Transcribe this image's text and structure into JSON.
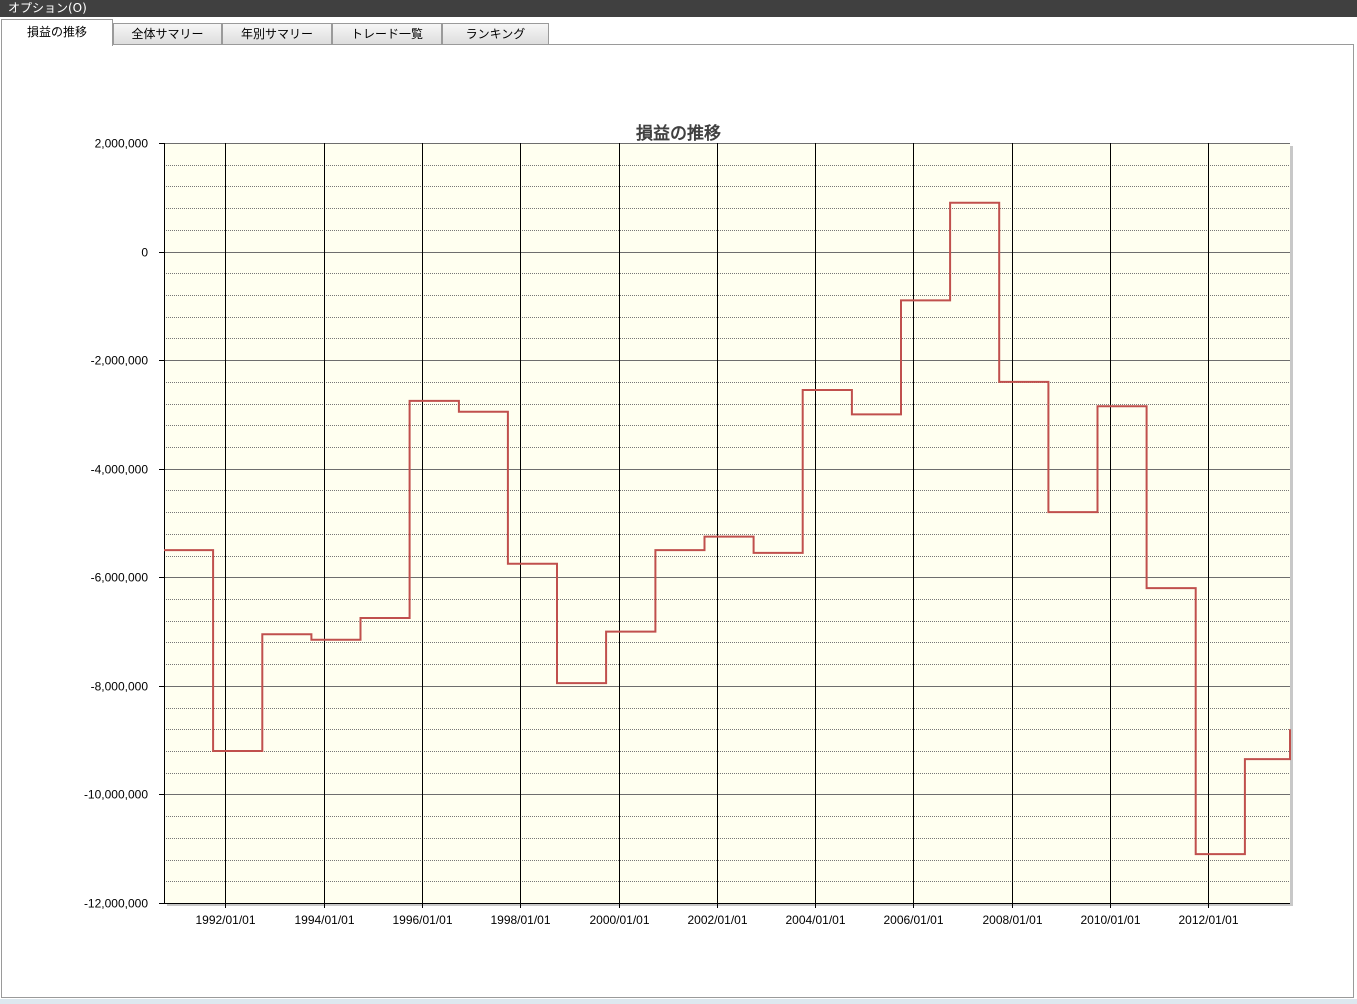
{
  "menu": {
    "options_label": "オプション(O)"
  },
  "tabs": [
    {
      "label": "損益の推移",
      "active": true
    },
    {
      "label": "全体サマリー",
      "active": false
    },
    {
      "label": "年別サマリー",
      "active": false
    },
    {
      "label": "トレード一覧",
      "active": false
    },
    {
      "label": "ランキング",
      "active": false
    }
  ],
  "colors": {
    "line": "#c0504d",
    "plot_background": "#fffff0",
    "menubar": "#404040"
  },
  "chart_data": {
    "type": "line",
    "title": "損益の推移",
    "xlabel": "",
    "ylabel": "",
    "ylim": [
      -12000000,
      2000000
    ],
    "xlim": [
      "1990/10/01",
      "2013/09/01"
    ],
    "y_ticks": [
      "2,000,000",
      "0",
      "-2,000,000",
      "-4,000,000",
      "-6,000,000",
      "-8,000,000",
      "-10,000,000",
      "-12,000,000"
    ],
    "x_ticks": [
      "1992/01/01",
      "1994/01/01",
      "1996/01/01",
      "1998/01/01",
      "2000/01/01",
      "2002/01/01",
      "2004/01/01",
      "2006/01/01",
      "2008/01/01",
      "2010/01/01",
      "2012/01/01"
    ],
    "grid": true,
    "minor_grid": true,
    "legend": "none",
    "step": true,
    "series": [
      {
        "x": [
          "1990/10/01",
          "1991/10/01",
          "1992/10/01",
          "1993/10/01",
          "1994/10/01",
          "1995/10/01",
          "1996/10/01",
          "1997/10/01",
          "1998/10/01",
          "1999/10/01",
          "2000/10/01",
          "2001/10/01",
          "2002/10/01",
          "2003/10/01",
          "2004/10/01",
          "2005/10/01",
          "2006/10/01",
          "2007/10/01",
          "2008/10/01",
          "2009/10/01",
          "2010/10/01",
          "2011/10/01",
          "2012/10/01",
          "2013/09/01"
        ],
        "y": [
          -5500000,
          -9200000,
          -7050000,
          -7150000,
          -6750000,
          -2750000,
          -2950000,
          -5750000,
          -7950000,
          -7000000,
          -5500000,
          -5250000,
          -5550000,
          -2550000,
          -3000000,
          -900000,
          900000,
          -2400000,
          -4800000,
          -2850000,
          -6200000,
          -11100000,
          -9350000,
          -8800000
        ]
      }
    ]
  }
}
